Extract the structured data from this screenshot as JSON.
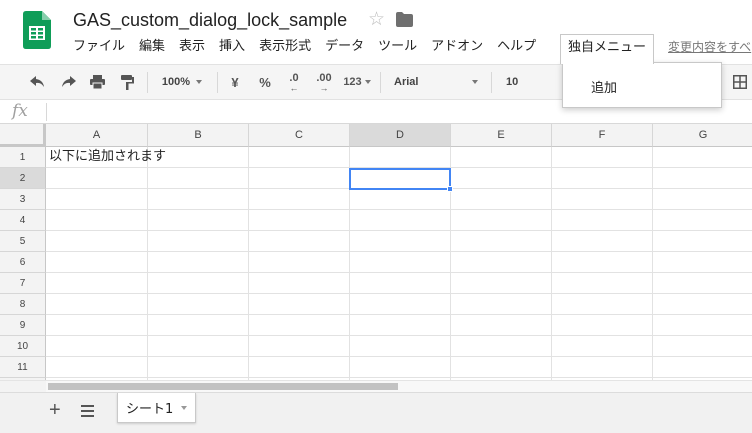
{
  "doc": {
    "title": "GAS_custom_dialog_lock_sample",
    "changes_link": "変更内容をすべ"
  },
  "menu": {
    "items": [
      "ファイル",
      "編集",
      "表示",
      "挿入",
      "表示形式",
      "データ",
      "ツール",
      "アドオン",
      "ヘルプ"
    ],
    "active": "独自メニュー",
    "dropdown_items": [
      "追加"
    ]
  },
  "toolbar": {
    "zoom": "100%",
    "currency": "¥",
    "percent": "%",
    "decimal_decrease": ".0",
    "decimal_increase": ".00",
    "number_format": "123",
    "font": "Arial",
    "font_size": "10"
  },
  "grid": {
    "columns": [
      "A",
      "B",
      "C",
      "D",
      "E",
      "F",
      "G"
    ],
    "rows": [
      "1",
      "2",
      "3",
      "4",
      "5",
      "6",
      "7",
      "8",
      "9",
      "10",
      "11"
    ],
    "selected_column": "D",
    "selected_row": "2",
    "cells": {
      "A1": "以下に追加されます"
    }
  },
  "sheets": {
    "tabs": [
      "シート1"
    ]
  },
  "colors": {
    "brand_green": "#0f9d58",
    "selection_blue": "#4285f4"
  }
}
